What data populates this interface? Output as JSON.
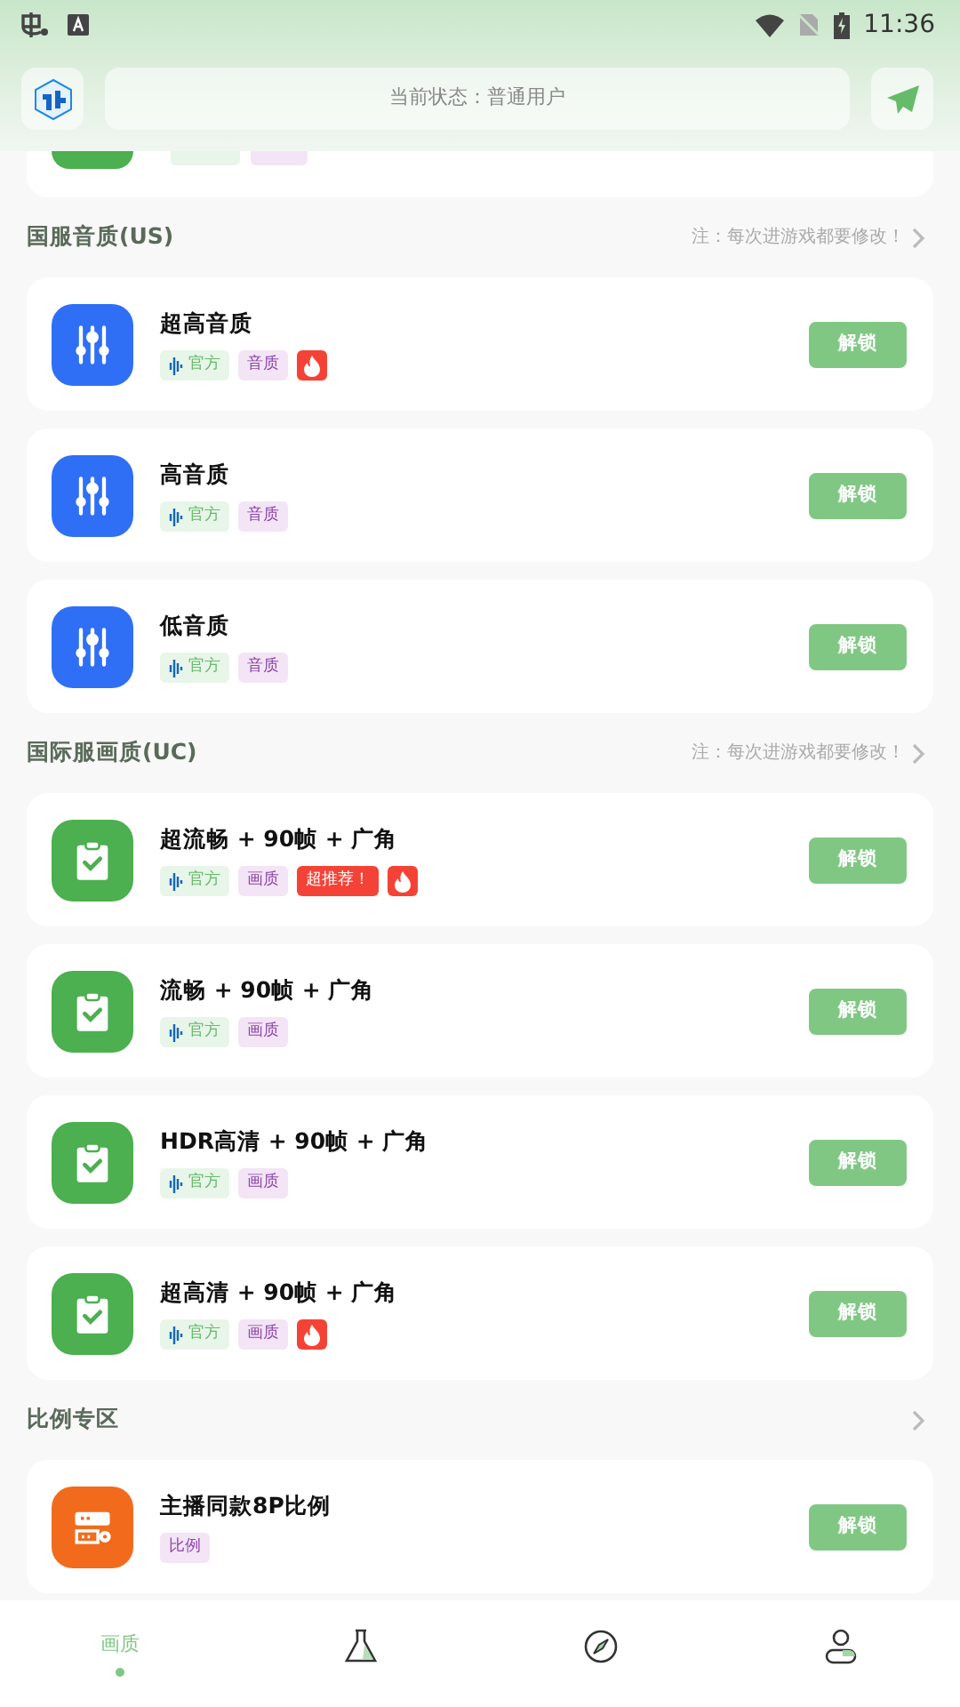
{
  "status_bar": {
    "time": "11:36"
  },
  "header": {
    "status_text": "当前状态：普通用户"
  },
  "sections": [
    {
      "title": "国服音质(US)",
      "note": "注：每次进游戏都要修改！",
      "items": [
        {
          "kind": "sound",
          "title": "超高音质",
          "button": "解锁",
          "tags": [
            {
              "kind": "official",
              "text": "官方"
            },
            {
              "kind": "category",
              "text": "音质"
            },
            {
              "kind": "hot"
            }
          ]
        },
        {
          "kind": "sound",
          "title": "高音质",
          "button": "解锁",
          "tags": [
            {
              "kind": "official",
              "text": "官方"
            },
            {
              "kind": "category",
              "text": "音质"
            }
          ]
        },
        {
          "kind": "sound",
          "title": "低音质",
          "button": "解锁",
          "tags": [
            {
              "kind": "official",
              "text": "官方"
            },
            {
              "kind": "category",
              "text": "音质"
            }
          ]
        }
      ]
    },
    {
      "title": "国际服画质(UC)",
      "note": "注：每次进游戏都要修改！",
      "items": [
        {
          "kind": "picture",
          "title": "超流畅 + 90帧 + 广角",
          "button": "解锁",
          "tags": [
            {
              "kind": "official",
              "text": "官方"
            },
            {
              "kind": "category",
              "text": "画质"
            },
            {
              "kind": "recommend",
              "text": "超推荐！"
            },
            {
              "kind": "hot"
            }
          ]
        },
        {
          "kind": "picture",
          "title": "流畅 + 90帧 + 广角",
          "button": "解锁",
          "tags": [
            {
              "kind": "official",
              "text": "官方"
            },
            {
              "kind": "category",
              "text": "画质"
            }
          ]
        },
        {
          "kind": "picture",
          "title": "HDR高清 + 90帧 + 广角",
          "button": "解锁",
          "tags": [
            {
              "kind": "official",
              "text": "官方"
            },
            {
              "kind": "category",
              "text": "画质"
            }
          ]
        },
        {
          "kind": "picture",
          "title": "超高清 + 90帧 + 广角",
          "button": "解锁",
          "tags": [
            {
              "kind": "official",
              "text": "官方"
            },
            {
              "kind": "category",
              "text": "画质"
            },
            {
              "kind": "hot"
            }
          ]
        }
      ]
    },
    {
      "title": "比例专区",
      "items": [
        {
          "kind": "ratio",
          "title": "主播同款8P比例",
          "button": "解锁",
          "tags": [
            {
              "kind": "category",
              "text": "比例"
            }
          ]
        }
      ]
    }
  ],
  "bottom_nav": [
    {
      "label": "画质",
      "selected": true
    },
    {
      "kind": "lab",
      "selected": false
    },
    {
      "kind": "compass",
      "selected": false
    },
    {
      "kind": "profile",
      "selected": false
    }
  ]
}
